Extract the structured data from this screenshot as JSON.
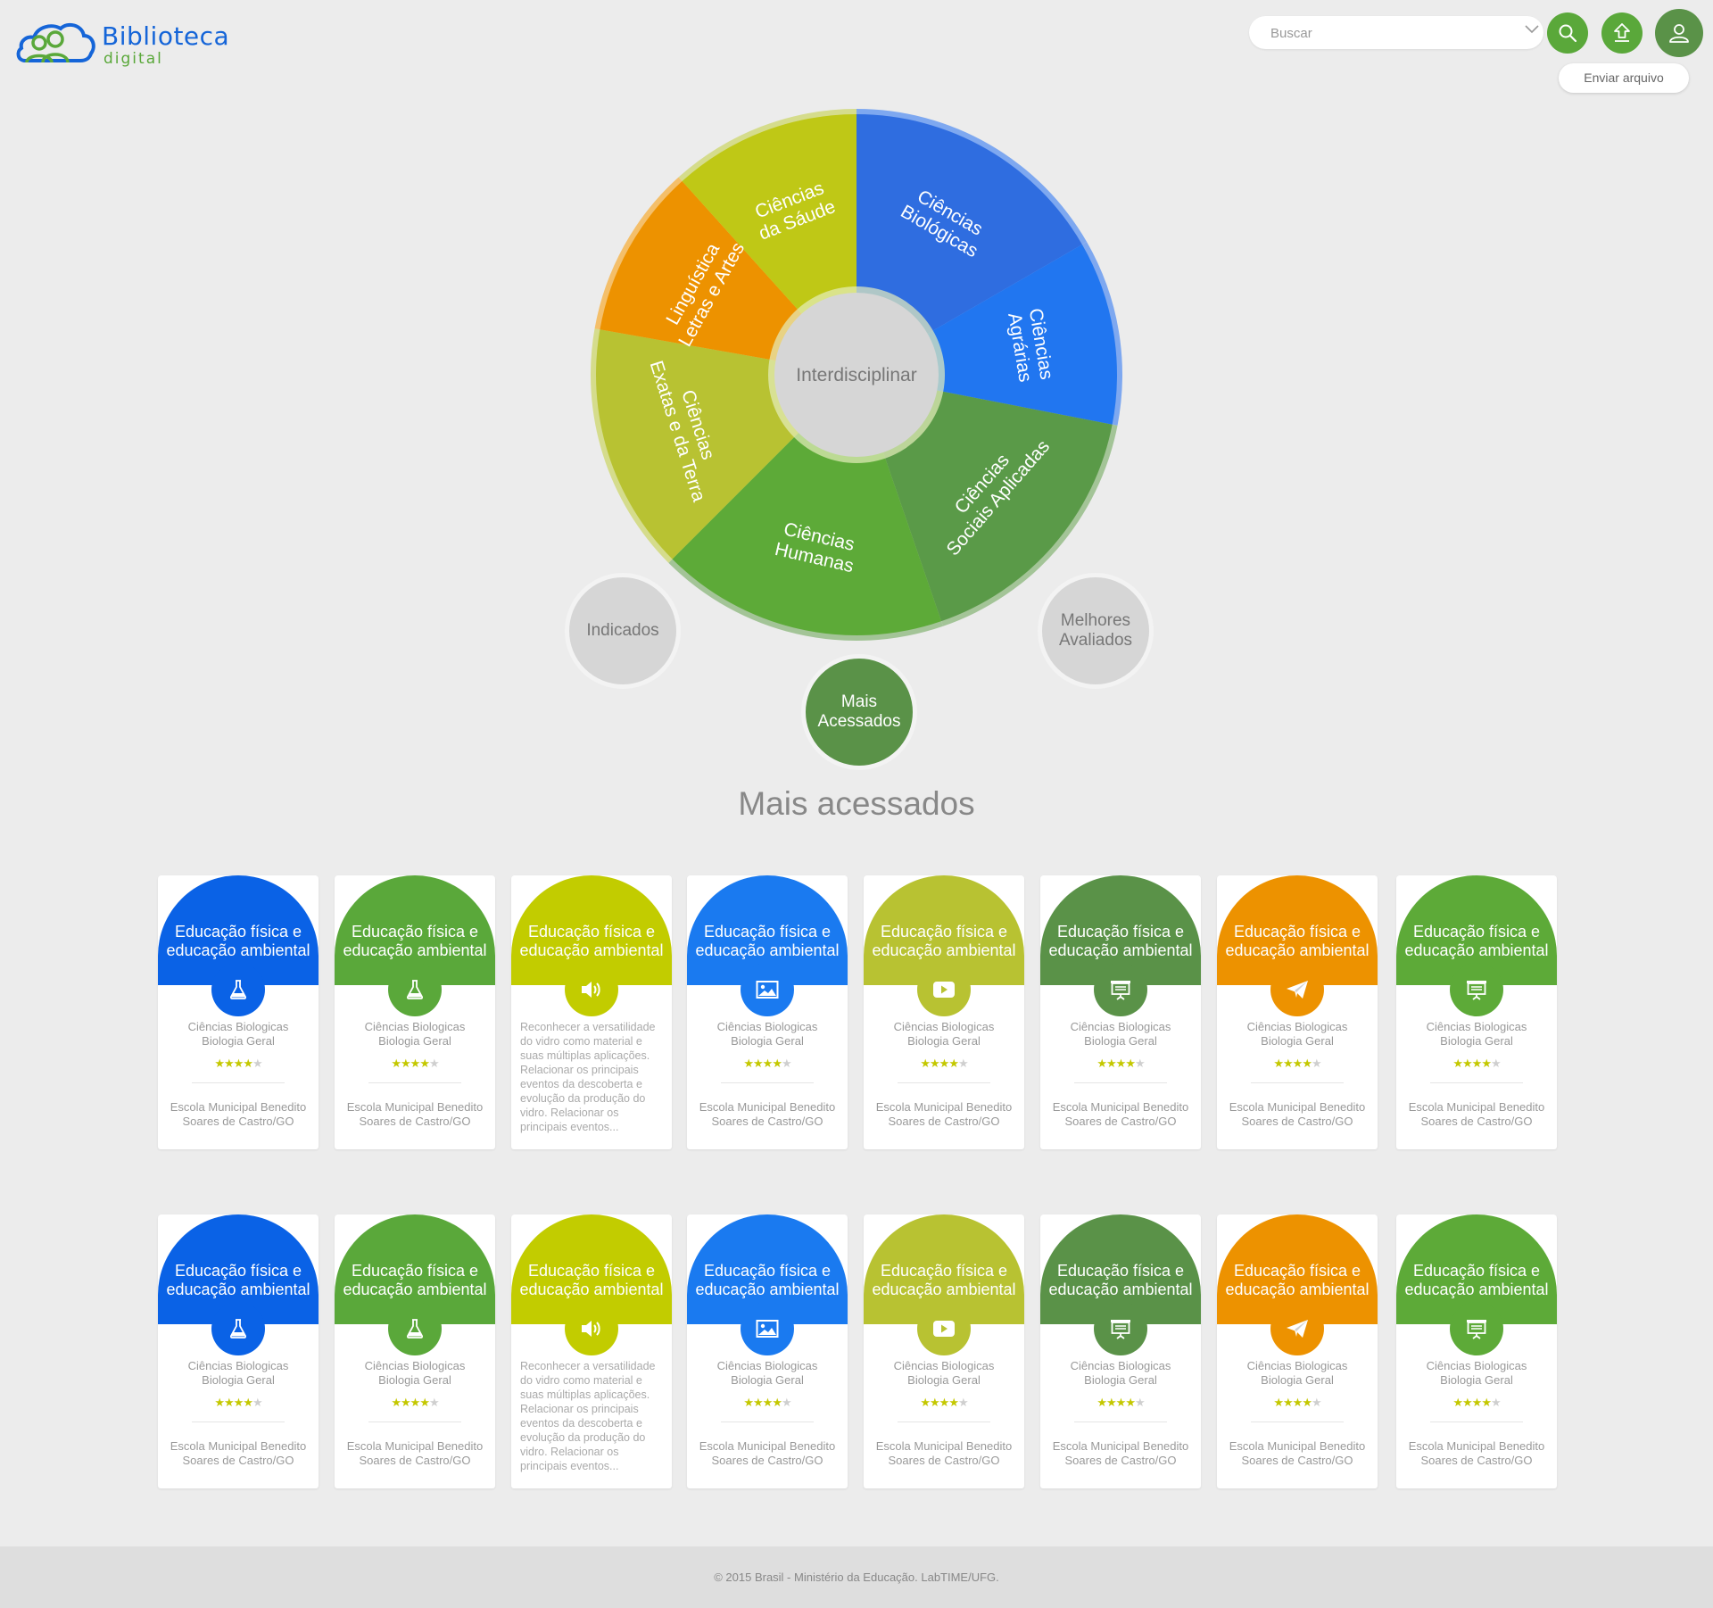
{
  "brand": {
    "title": "Biblioteca",
    "subtitle": "digital",
    "primary": "#1565d8",
    "secondary": "#5aa83a"
  },
  "search": {
    "placeholder": "Buscar",
    "value": ""
  },
  "header": {
    "upload_tooltip": "Enviar arquivo"
  },
  "wheel": {
    "center": "Interdisciplinar",
    "segments": [
      {
        "lines": [
          "Ciências",
          "Biológicas"
        ],
        "color": "#2f6de0"
      },
      {
        "lines": [
          "Ciências",
          "Agrárias"
        ],
        "color": "#2176f0"
      },
      {
        "lines": [
          "Ciências",
          "Sociais Aplicadas"
        ],
        "color": "#5a9a48"
      },
      {
        "lines": [
          "Ciências",
          "Humanas"
        ],
        "color": "#5daa38"
      },
      {
        "lines": [
          "Ciências",
          "Exatas e da Terra"
        ],
        "color": "#b8c232"
      },
      {
        "lines": [
          "Linguística",
          "Letras e Artes"
        ],
        "color": "#ed9200"
      },
      {
        "lines": [
          "Ciências",
          "da Sáude"
        ],
        "color": "#bfc816"
      }
    ]
  },
  "filters": {
    "indicados": "Indicados",
    "mais_acessados": [
      "Mais",
      "Acessados"
    ],
    "melhores_avaliados": [
      "Melhores",
      "Avaliados"
    ]
  },
  "section_title": "Mais acessados",
  "cards": [
    {
      "title": [
        "Educação física e",
        "educação ambiental"
      ],
      "color": "#0a62e6",
      "icon": "flask-icon",
      "area": [
        "Ciências Biologicas",
        "Biologia Geral"
      ],
      "rating": 4,
      "school": [
        "Escola Municipal Benedito",
        "Soares de Castro/GO"
      ]
    },
    {
      "title": [
        "Educação física e",
        "educação ambiental"
      ],
      "color": "#5aa83a",
      "icon": "flask-icon",
      "area": [
        "Ciências Biologicas",
        "Biologia Geral"
      ],
      "rating": 4,
      "school": [
        "Escola Municipal Benedito",
        "Soares de Castro/GO"
      ]
    },
    {
      "title": [
        "Educação física e",
        "educação ambiental"
      ],
      "color": "#c2cc00",
      "icon": "speaker-icon",
      "description": [
        "Reconhecer a versatilidade",
        "do vidro como material e",
        "suas múltiplas aplicações.",
        "Relacionar os principais",
        "eventos da descoberta e",
        "evolução da produção do",
        "vidro. Relacionar os",
        "principais eventos..."
      ]
    },
    {
      "title": [
        "Educação física e",
        "educação ambiental"
      ],
      "color": "#1a7af0",
      "icon": "image-icon",
      "area": [
        "Ciências Biologicas",
        "Biologia Geral"
      ],
      "rating": 4,
      "school": [
        "Escola Municipal Benedito",
        "Soares de Castro/GO"
      ]
    },
    {
      "title": [
        "Educação física e",
        "educação ambiental"
      ],
      "color": "#b8c232",
      "icon": "play-icon",
      "area": [
        "Ciências Biologicas",
        "Biologia Geral"
      ],
      "rating": 4,
      "school": [
        "Escola Municipal Benedito",
        "Soares de Castro/GO"
      ]
    },
    {
      "title": [
        "Educação física e",
        "educação ambiental"
      ],
      "color": "#5a9248",
      "icon": "presentation-icon",
      "area": [
        "Ciências Biologicas",
        "Biologia Geral"
      ],
      "rating": 4,
      "school": [
        "Escola Municipal Benedito",
        "Soares de Castro/GO"
      ]
    },
    {
      "title": [
        "Educação física e",
        "educação ambiental"
      ],
      "color": "#ed9200",
      "icon": "paper-plane-icon",
      "area": [
        "Ciências Biologicas",
        "Biologia Geral"
      ],
      "rating": 4,
      "school": [
        "Escola Municipal Benedito",
        "Soares de Castro/GO"
      ]
    },
    {
      "title": [
        "Educação física e",
        "educação ambiental"
      ],
      "color": "#5daa38",
      "icon": "presentation-icon",
      "area": [
        "Ciências Biologicas",
        "Biologia Geral"
      ],
      "rating": 4,
      "school": [
        "Escola Municipal Benedito",
        "Soares de Castro/GO"
      ]
    }
  ],
  "footer": "© 2015 Brasil - Ministério da Educação. LabTIME/UFG."
}
